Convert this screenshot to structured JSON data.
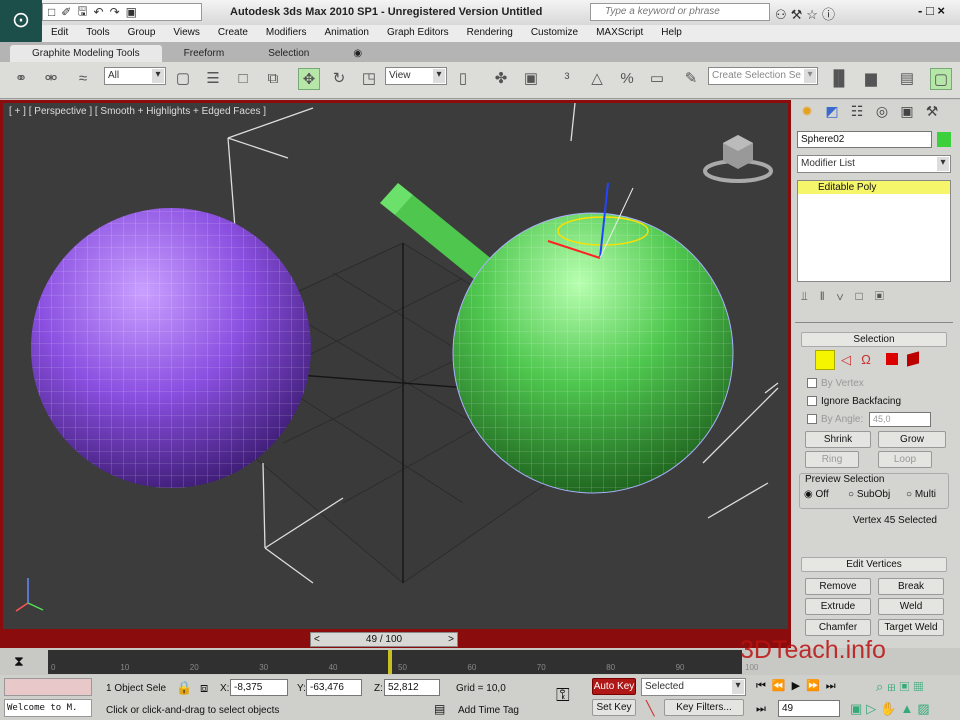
{
  "app": {
    "title": "Autodesk 3ds Max 2010 SP1 - Unregistered Version    Untitled",
    "search_placeholder": "Type a keyword or phrase"
  },
  "menu": [
    "Edit",
    "Tools",
    "Group",
    "Views",
    "Create",
    "Modifiers",
    "Animation",
    "Graph Editors",
    "Rendering",
    "Customize",
    "MAXScript",
    "Help"
  ],
  "ribbon_tabs": [
    "Graphite Modeling Tools",
    "Freeform",
    "Selection"
  ],
  "toolbar": {
    "filter": "All",
    "ref_coord": "View",
    "selection_set_placeholder": "Create Selection Se"
  },
  "viewport": {
    "label": "[ + ] [ Perspective ] [ Smooth + Highlights + Edged Faces ]",
    "colors": {
      "sphere1": "#8a4fe0",
      "sphere2": "#4fc74f",
      "box": "#4fc74f"
    }
  },
  "command_panel": {
    "object_name": "Sphere02",
    "object_color": "#3cd03c",
    "modifier_list": "Modifier List",
    "stack": [
      "Editable Poly"
    ],
    "selection": {
      "title": "Selection",
      "by_vertex": "By Vertex",
      "ignore_backfacing": "Ignore Backfacing",
      "by_angle": "By Angle:",
      "angle_value": "45,0",
      "shrink": "Shrink",
      "grow": "Grow",
      "ring": "Ring",
      "loop": "Loop",
      "preview_title": "Preview Selection",
      "preview_options": [
        "Off",
        "SubObj",
        "Multi"
      ],
      "status": "Vertex 45 Selected"
    },
    "edit_vertices": {
      "title": "Edit Vertices",
      "buttons": [
        "Remove",
        "Break",
        "Extrude",
        "Weld",
        "Chamfer",
        "Target Weld"
      ]
    }
  },
  "timeline": {
    "frame_display": "49 / 100",
    "current_frame": 49,
    "total_frames": 100,
    "ticks": [
      "0",
      "10",
      "20",
      "30",
      "40",
      "50",
      "60",
      "70",
      "80",
      "90",
      "100"
    ]
  },
  "status": {
    "maxscript": "Welcome to M.",
    "selection": "1 Object Sele",
    "x_label": "X:",
    "x": "-8,375",
    "y_label": "Y:",
    "y": "-63,476",
    "z_label": "Z:",
    "z": "52,812",
    "grid": "Grid = 10,0",
    "prompt": "Click or click-and-drag to select objects",
    "add_time_tag": "Add Time Tag",
    "auto_key": "Auto Key",
    "set_key": "Set Key",
    "key_mode": "Selected",
    "key_filters": "Key Filters...",
    "frame": "49"
  },
  "watermark": "3DTeach.info"
}
